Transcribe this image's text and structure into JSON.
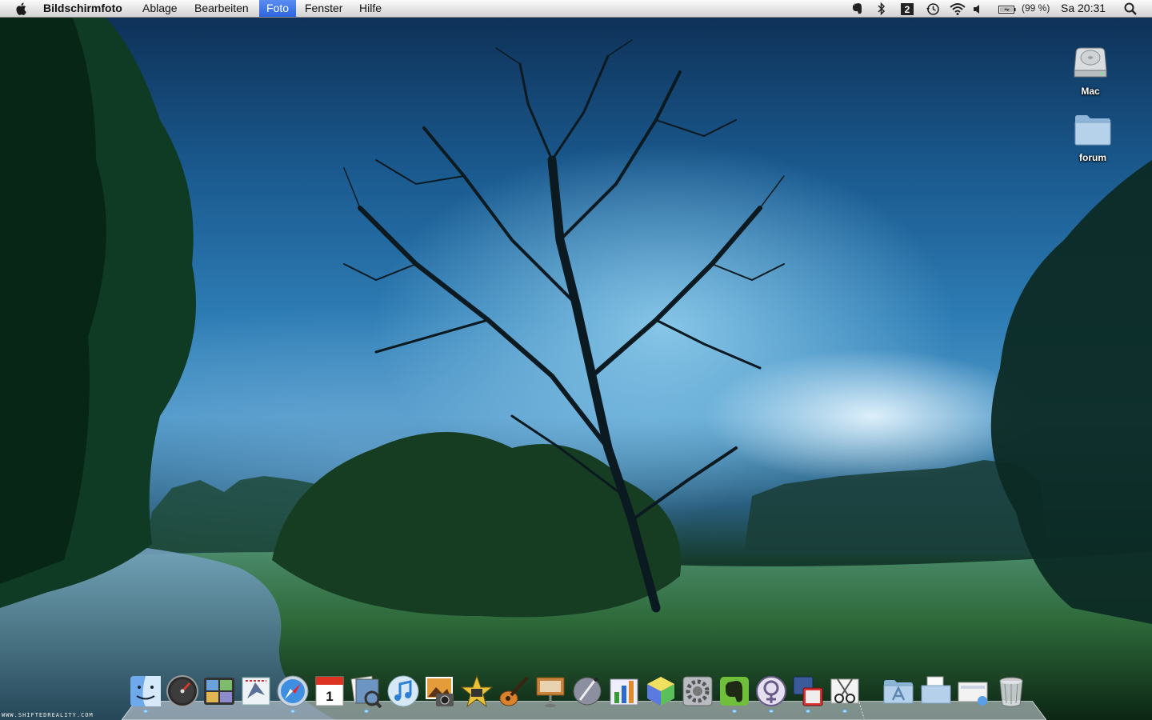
{
  "menubar": {
    "app_name": "Bildschirmfoto",
    "menus": [
      "Ablage",
      "Bearbeiten",
      "Foto",
      "Fenster",
      "Hilfe"
    ],
    "active_menu": "Foto",
    "status_icons": [
      "evernote-status-icon",
      "bluetooth-icon",
      "spaces-icon",
      "time-machine-icon",
      "wifi-icon",
      "volume-icon",
      "battery-icon",
      "spotlight-icon"
    ],
    "battery_percent": "(99 %)",
    "clock": "Sa 20:31"
  },
  "desktop_icons": [
    {
      "label": "Mac",
      "icon": "hard-drive-icon"
    },
    {
      "label": "forum",
      "icon": "folder-icon"
    }
  ],
  "dock": {
    "apps": [
      {
        "name": "finder-icon",
        "running": true
      },
      {
        "name": "dashboard-icon",
        "running": false
      },
      {
        "name": "spaces-icon",
        "running": false
      },
      {
        "name": "mail-icon",
        "running": false
      },
      {
        "name": "safari-icon",
        "running": true
      },
      {
        "name": "ical-icon",
        "running": false
      },
      {
        "name": "preview-icon",
        "running": true
      },
      {
        "name": "itunes-icon",
        "running": false
      },
      {
        "name": "iphoto-icon",
        "running": false
      },
      {
        "name": "imovie-icon",
        "running": false
      },
      {
        "name": "garageband-icon",
        "running": false
      },
      {
        "name": "keynote-icon",
        "running": false
      },
      {
        "name": "script-editor-icon",
        "running": false
      },
      {
        "name": "numbers-icon",
        "running": false
      },
      {
        "name": "colorsync-icon",
        "running": false
      },
      {
        "name": "system-preferences-icon",
        "running": false
      },
      {
        "name": "evernote-icon",
        "running": true
      },
      {
        "name": "adium-icon",
        "running": true
      },
      {
        "name": "vmware-fusion-icon",
        "running": true
      },
      {
        "name": "grab-icon",
        "running": true
      }
    ],
    "stacks": [
      "applications-stack-icon",
      "documents-stack-icon",
      "downloads-stack-icon",
      "trash-icon"
    ]
  },
  "watermark": "WWW.SHIFTEDREALITY.COM"
}
